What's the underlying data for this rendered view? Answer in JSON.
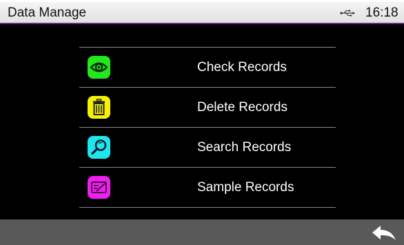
{
  "header": {
    "title": "Data Manage",
    "usb_icon": "usb-icon",
    "time": "16:18"
  },
  "menu": {
    "items": [
      {
        "label": "Check Records",
        "icon": "eye-icon",
        "color": "#22e81a"
      },
      {
        "label": "Delete Records",
        "icon": "trash-icon",
        "color": "#f5f200"
      },
      {
        "label": "Search Records",
        "icon": "magnifier-icon",
        "color": "#1ee6ee"
      },
      {
        "label": "Sample Records",
        "icon": "sample-card-icon",
        "color": "#f21ef0"
      }
    ]
  },
  "footer": {
    "back_icon": "back-arrow-icon"
  },
  "colors": {
    "header_accent": "#6a2a86",
    "footer_bg": "#595959"
  }
}
